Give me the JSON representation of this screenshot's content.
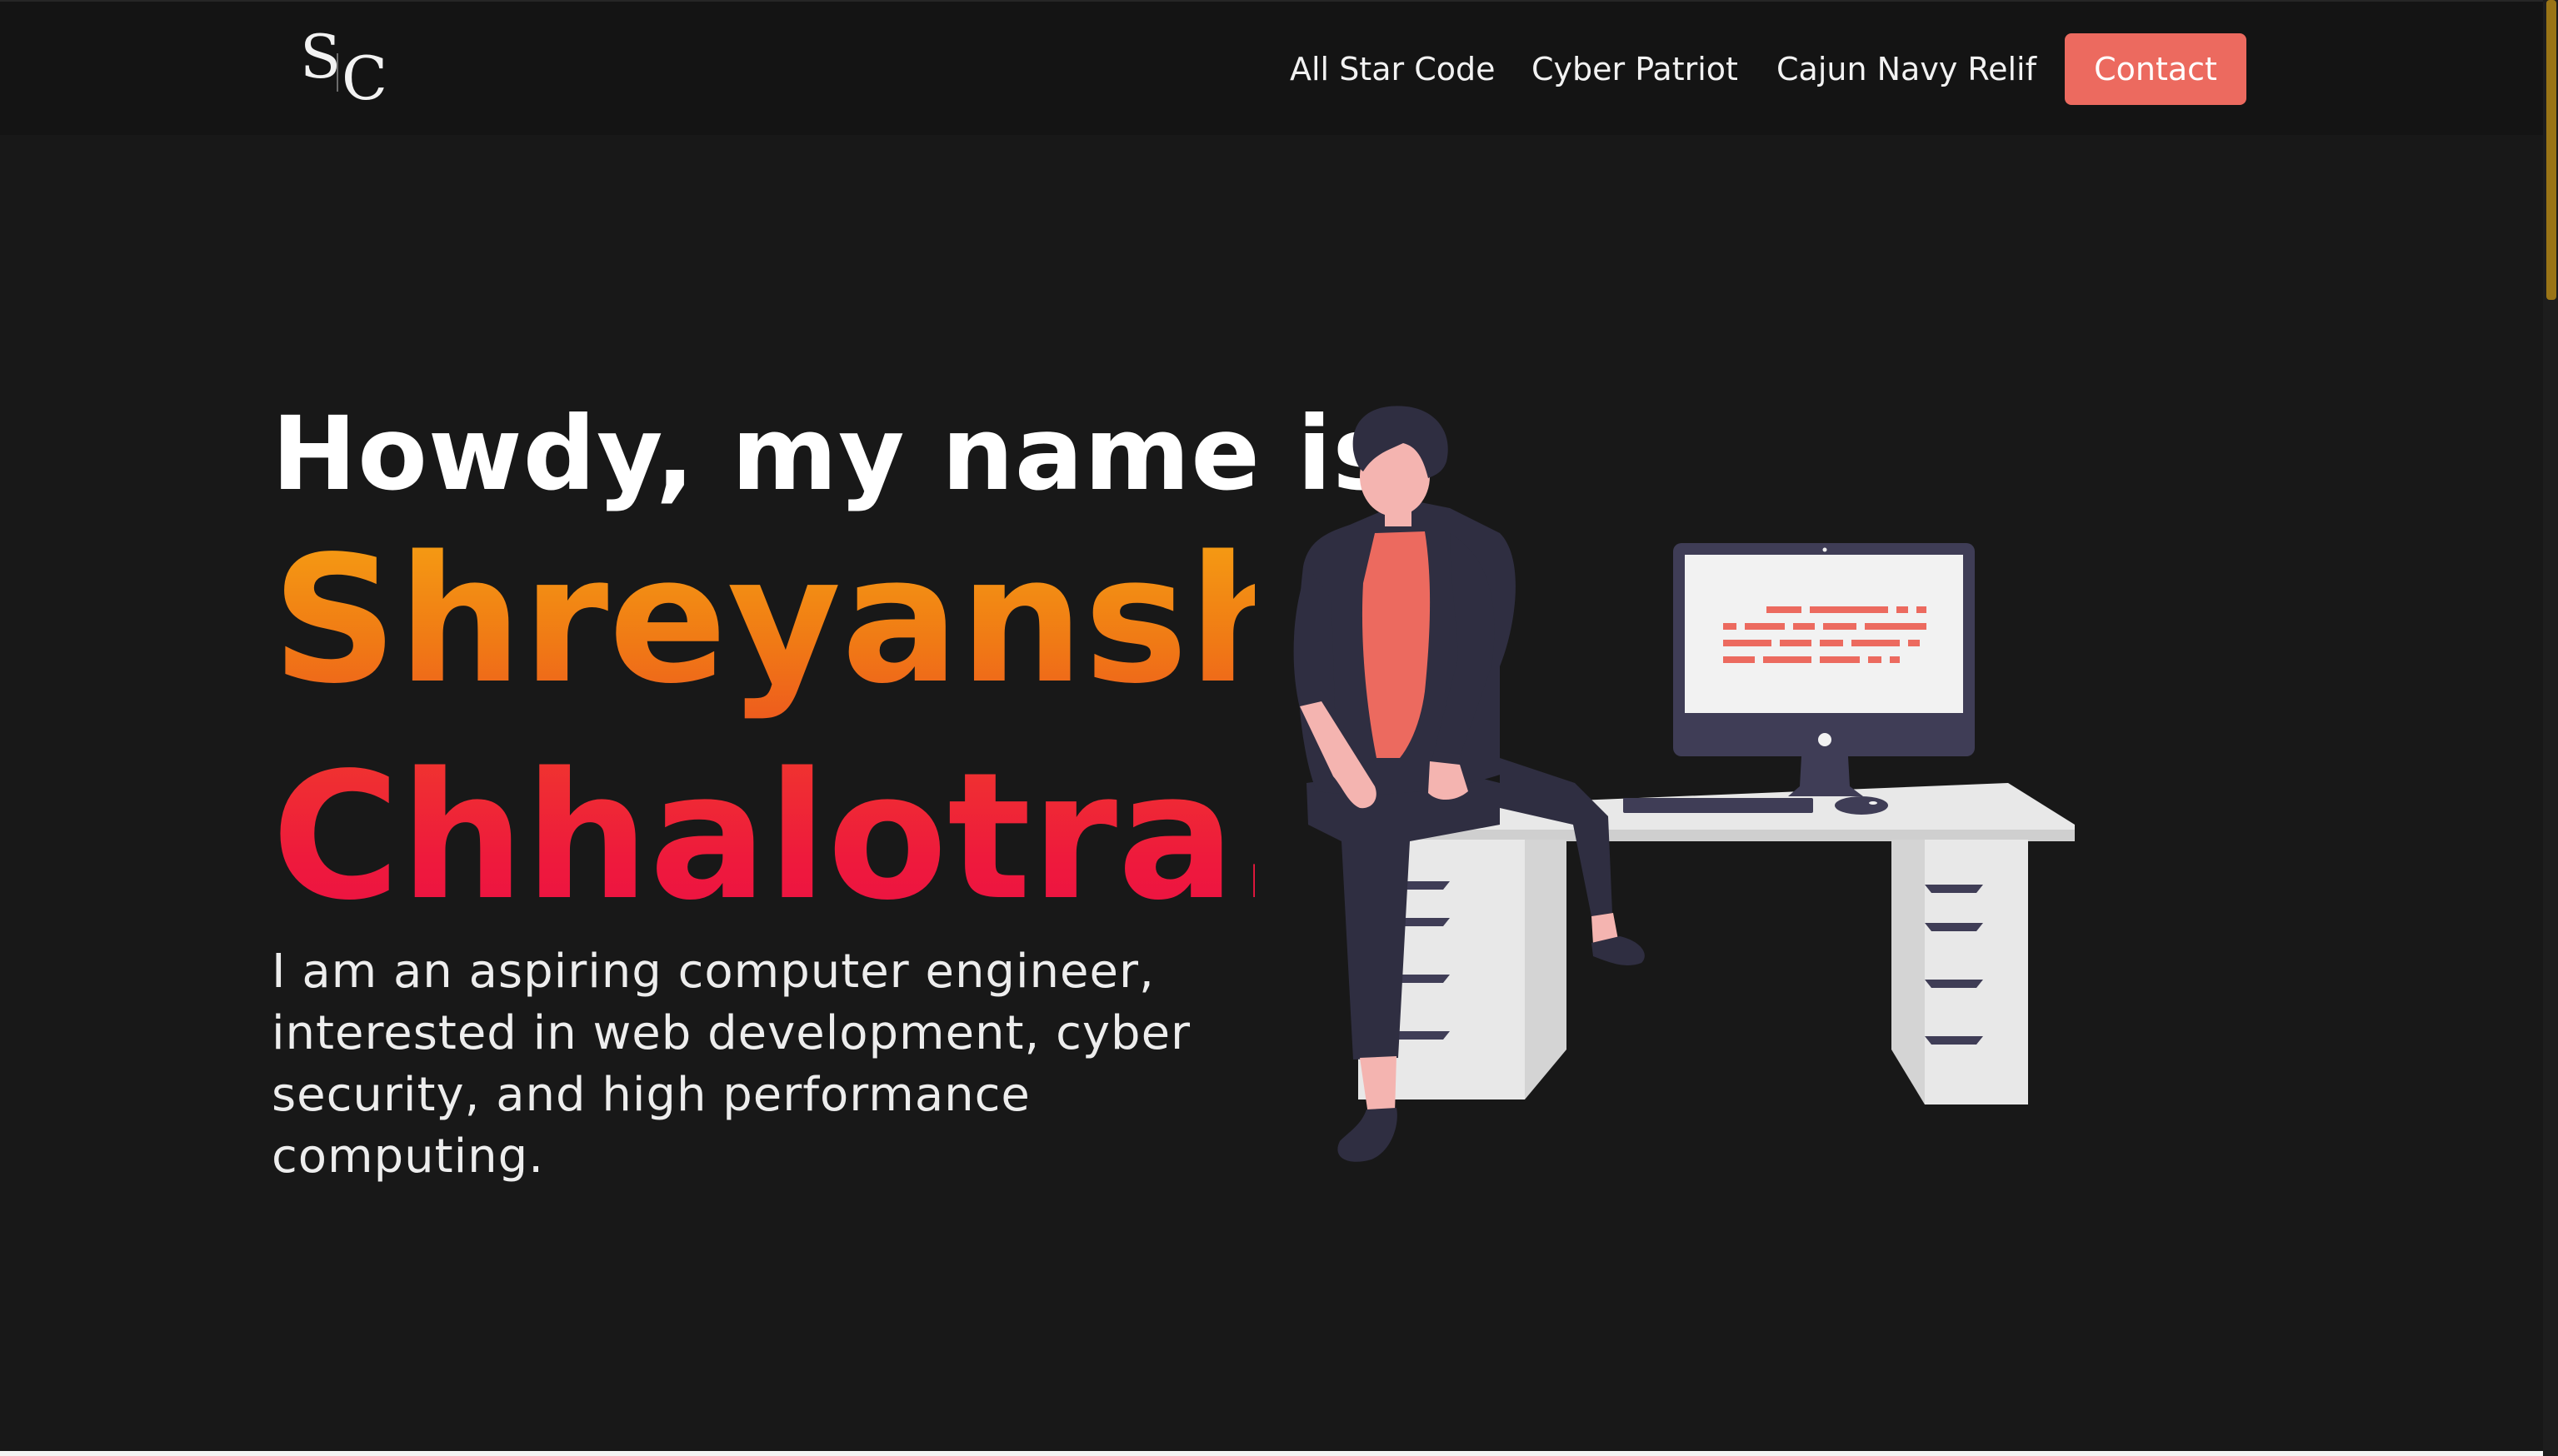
{
  "header": {
    "logo": {
      "letters": "SC"
    },
    "nav": [
      {
        "label": "All Star Code"
      },
      {
        "label": "Cyber Patriot"
      },
      {
        "label": "Cajun Navy Relif"
      }
    ],
    "contact_label": "Contact"
  },
  "hero": {
    "greeting": "Howdy, my name is",
    "first_name": "Shreyansh",
    "last_name": "Chhalotra.",
    "bio": "I am an aspiring computer engineer, interested in web development, cyber security, and high performance computing."
  },
  "illustration": {
    "subject": "person-sitting-on-desk-with-computer",
    "colors": {
      "accent": "#ec6a5f",
      "dark": "#2f2e41",
      "desk": "#e6e6e6",
      "skin": "#f4b4b0"
    }
  },
  "theme": {
    "background": "#181818",
    "navbar": "#141414",
    "name_gradient_top": "#f6a312",
    "name_gradient_bottom": "#ec0f45",
    "button": "#ec6a5f",
    "scrollbar": "#9a7416"
  }
}
